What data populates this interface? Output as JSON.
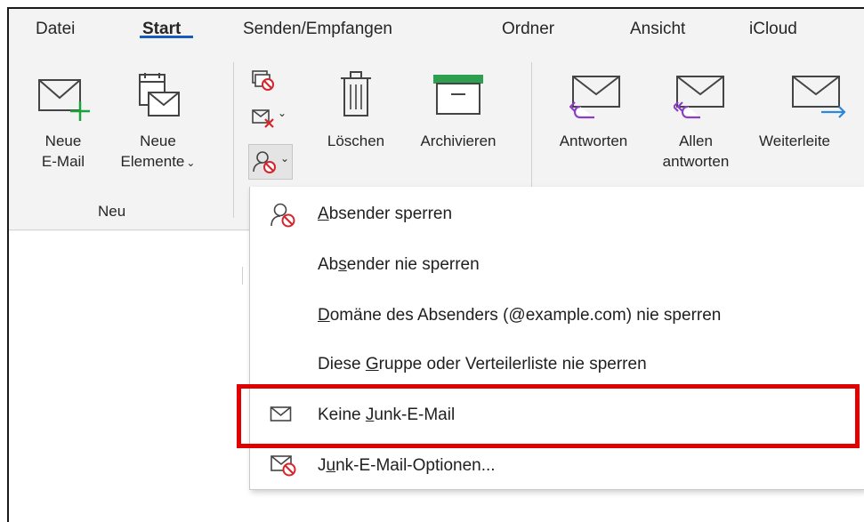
{
  "tabs": {
    "file": "Datei",
    "home": "Start",
    "send_receive": "Senden/Empfangen",
    "folder": "Ordner",
    "view": "Ansicht",
    "icloud": "iCloud"
  },
  "ribbon": {
    "new_email_line1": "Neue",
    "new_email_line2": "E-Mail",
    "new_items_line1": "Neue",
    "new_items_line2": "Elemente",
    "group_new": "Neu",
    "delete": "Löschen",
    "archive": "Archivieren",
    "reply": "Antworten",
    "reply_all_line1": "Allen",
    "reply_all_line2": "antworten",
    "forward": "Weiterleite"
  },
  "menu": {
    "items": [
      {
        "pre": "",
        "u": "A",
        "post": "bsender sperren",
        "icon": "block-sender-icon"
      },
      {
        "pre": "Ab",
        "u": "s",
        "post": "ender nie sperren",
        "icon": ""
      },
      {
        "pre": "",
        "u": "D",
        "post": "omäne des Absenders (@example.com) nie sperren",
        "icon": ""
      },
      {
        "pre": "Diese ",
        "u": "G",
        "post": "ruppe oder Verteilerliste nie sperren",
        "icon": ""
      },
      {
        "pre": "Keine ",
        "u": "J",
        "post": "unk-E-Mail",
        "icon": "envelope-icon"
      },
      {
        "pre": "J",
        "u": "u",
        "post": "nk-E-Mail-Optionen...",
        "icon": "junk-options-icon"
      }
    ]
  },
  "colors": {
    "accent": "#185abd",
    "highlight": "#e00000",
    "green_plus": "#1aa33b",
    "purple_arrow": "#8b3fc7",
    "blue_arrow": "#2e86de",
    "red_block": "#d8232a",
    "archive_green": "#2e9e4f"
  }
}
